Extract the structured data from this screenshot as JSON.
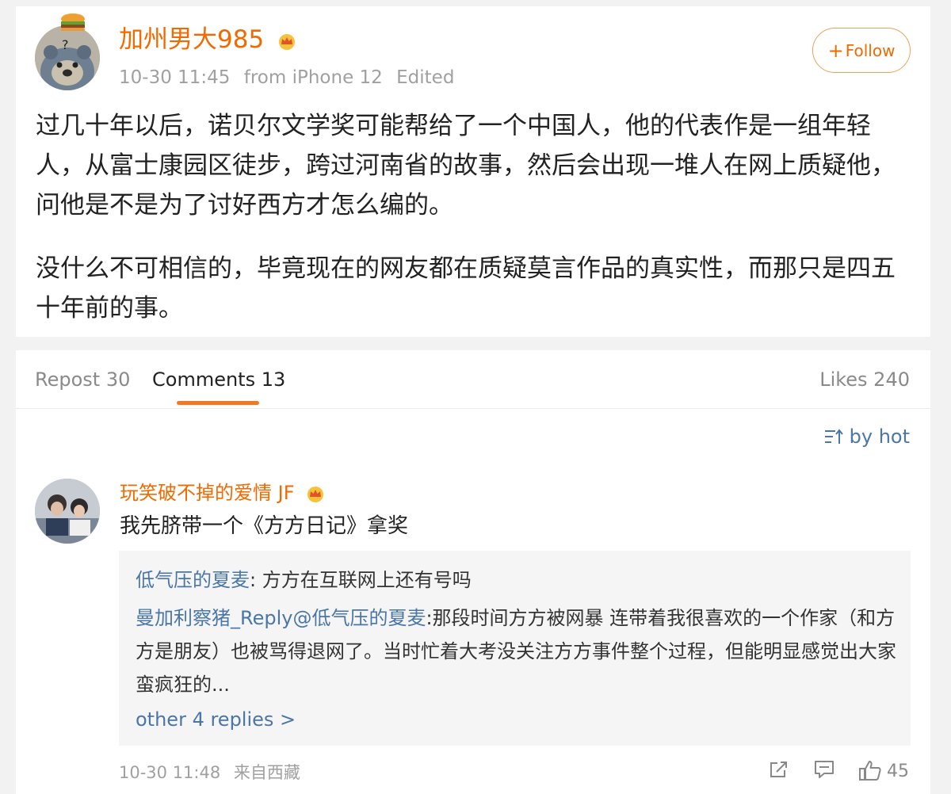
{
  "post": {
    "username": "加州男大985",
    "time": "10-30 11:45",
    "source": "from iPhone 12",
    "edited": "Edited",
    "follow_plus": "+",
    "follow_label": "Follow",
    "paragraph_1": "过几十年以后，诺贝尔文学奖可能帮给了一个中国人，他的代表作是一组年轻人，从富士康园区徒步，跨过河南省的故事，然后会出现一堆人在网上质疑他，问他是不是为了讨好西方才怎么编的。",
    "paragraph_2": "没什么不可相信的，毕竟现在的网友都在质疑莫言作品的真实性，而那只是四五十年前的事。"
  },
  "tabs": {
    "repost": "Repost 30",
    "comments": "Comments 13",
    "likes": "Likes 240"
  },
  "sort": {
    "label": "by hot"
  },
  "comment": {
    "username": "玩笑破不掉的爱情 JF",
    "text": "我先脐带一个《方方日记》拿奖",
    "replies": [
      {
        "user": "低气压的夏麦",
        "text": ": 方方在互联网上还有号吗"
      },
      {
        "user": "曼加利察猪_Reply@低气压的夏麦",
        "text": ":那段时间方方被网暴 连带着我很喜欢的一个作家（和方方是朋友）也被骂得退网了。当时忙着大考没关注方方事件整个过程，但能明显感觉出大家蛮疯狂的..."
      }
    ],
    "more_replies": "other 4 replies >",
    "time": "10-30 11:48",
    "source": "来自西藏",
    "likes": "45"
  },
  "colors": {
    "accent_orange": "#f06a00",
    "link_blue": "#4a76a8",
    "meta_gray": "#a0a0a0"
  },
  "icons": [
    "hamburger-badge-icon",
    "crown-icon",
    "sort-icon",
    "forward-icon",
    "comment-icon",
    "thumbs-up-icon"
  ]
}
